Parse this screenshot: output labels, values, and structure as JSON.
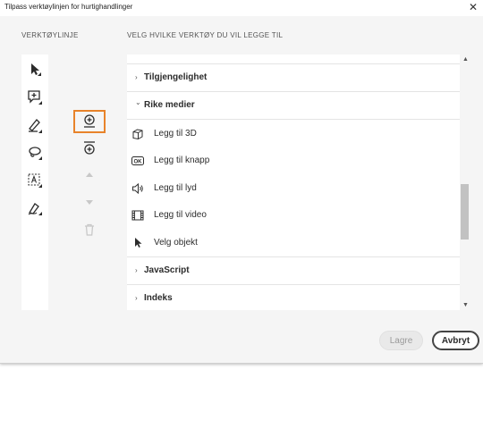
{
  "window": {
    "title": "Tilpass verktøylinjen for hurtighandlinger",
    "close_glyph": "✕"
  },
  "labels": {
    "toolbar": "VERKTØYLINJE",
    "choose_tools": "VELG HVILKE VERKTØY DU VIL LEGGE TIL"
  },
  "list": {
    "categories": [
      {
        "label": "Tilgjengelighet",
        "chevron": "›"
      },
      {
        "label": "Rike medier",
        "chevron": "⌄"
      },
      {
        "label": "JavaScript",
        "chevron": "›"
      },
      {
        "label": "Indeks",
        "chevron": "›"
      }
    ],
    "items": [
      {
        "label": "Legg til 3D",
        "icon": "cube-icon"
      },
      {
        "label": "Legg til knapp",
        "icon": "ok-button-icon"
      },
      {
        "label": "Legg til lyd",
        "icon": "speaker-icon"
      },
      {
        "label": "Legg til video",
        "icon": "film-icon"
      },
      {
        "label": "Velg objekt",
        "icon": "pointer-icon"
      }
    ]
  },
  "buttons": {
    "save": "Lagre",
    "cancel": "Avbryt"
  },
  "colors": {
    "selection_border": "#e8832a"
  }
}
